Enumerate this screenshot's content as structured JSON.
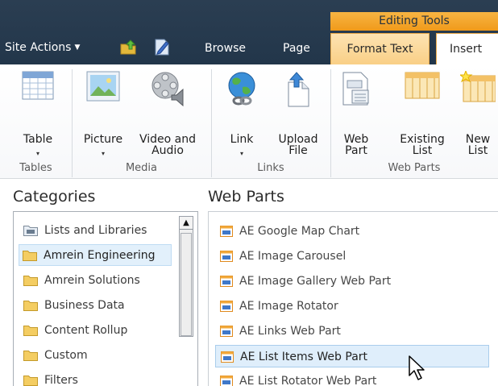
{
  "topbar": {
    "site_actions": "Site Actions",
    "tabs": {
      "browse": "Browse",
      "page": "Page",
      "format_text": "Format Text",
      "insert": "Insert"
    },
    "contextual_group": "Editing Tools"
  },
  "ribbon": {
    "buttons": {
      "table": "Table",
      "picture": "Picture",
      "video_audio_line1": "Video and",
      "video_audio_line2": "Audio",
      "link": "Link",
      "upload_line1": "Upload",
      "upload_line2": "File",
      "webpart_line1": "Web",
      "webpart_line2": "Part",
      "existing_line1": "Existing",
      "existing_line2": "List",
      "new_line1": "New",
      "new_line2": "List"
    },
    "groups": {
      "tables": "Tables",
      "media": "Media",
      "links": "Links",
      "web_parts": "Web Parts"
    },
    "dropdown_glyph": "▾"
  },
  "categories": {
    "heading": "Categories",
    "items": [
      {
        "label": "Lists and Libraries"
      },
      {
        "label": "Amrein Engineering"
      },
      {
        "label": "Amrein Solutions"
      },
      {
        "label": "Business Data"
      },
      {
        "label": "Content Rollup"
      },
      {
        "label": "Custom"
      },
      {
        "label": "Filters"
      }
    ],
    "selected_index": 1
  },
  "web_parts": {
    "heading": "Web Parts",
    "items": [
      {
        "label": "AE Google Map Chart"
      },
      {
        "label": "AE Image Carousel"
      },
      {
        "label": "AE Image Gallery Web Part"
      },
      {
        "label": "AE Image Rotator"
      },
      {
        "label": "AE Links Web Part"
      },
      {
        "label": "AE List Items Web Part"
      },
      {
        "label": "AE List Rotator Web Part"
      }
    ],
    "selected_index": 5
  },
  "scrollbar": {
    "up_arrow": "▲"
  },
  "colors": {
    "topbar": "#22364a",
    "contextual_orange": "#f09a1a",
    "selection": "#dfeefb"
  }
}
